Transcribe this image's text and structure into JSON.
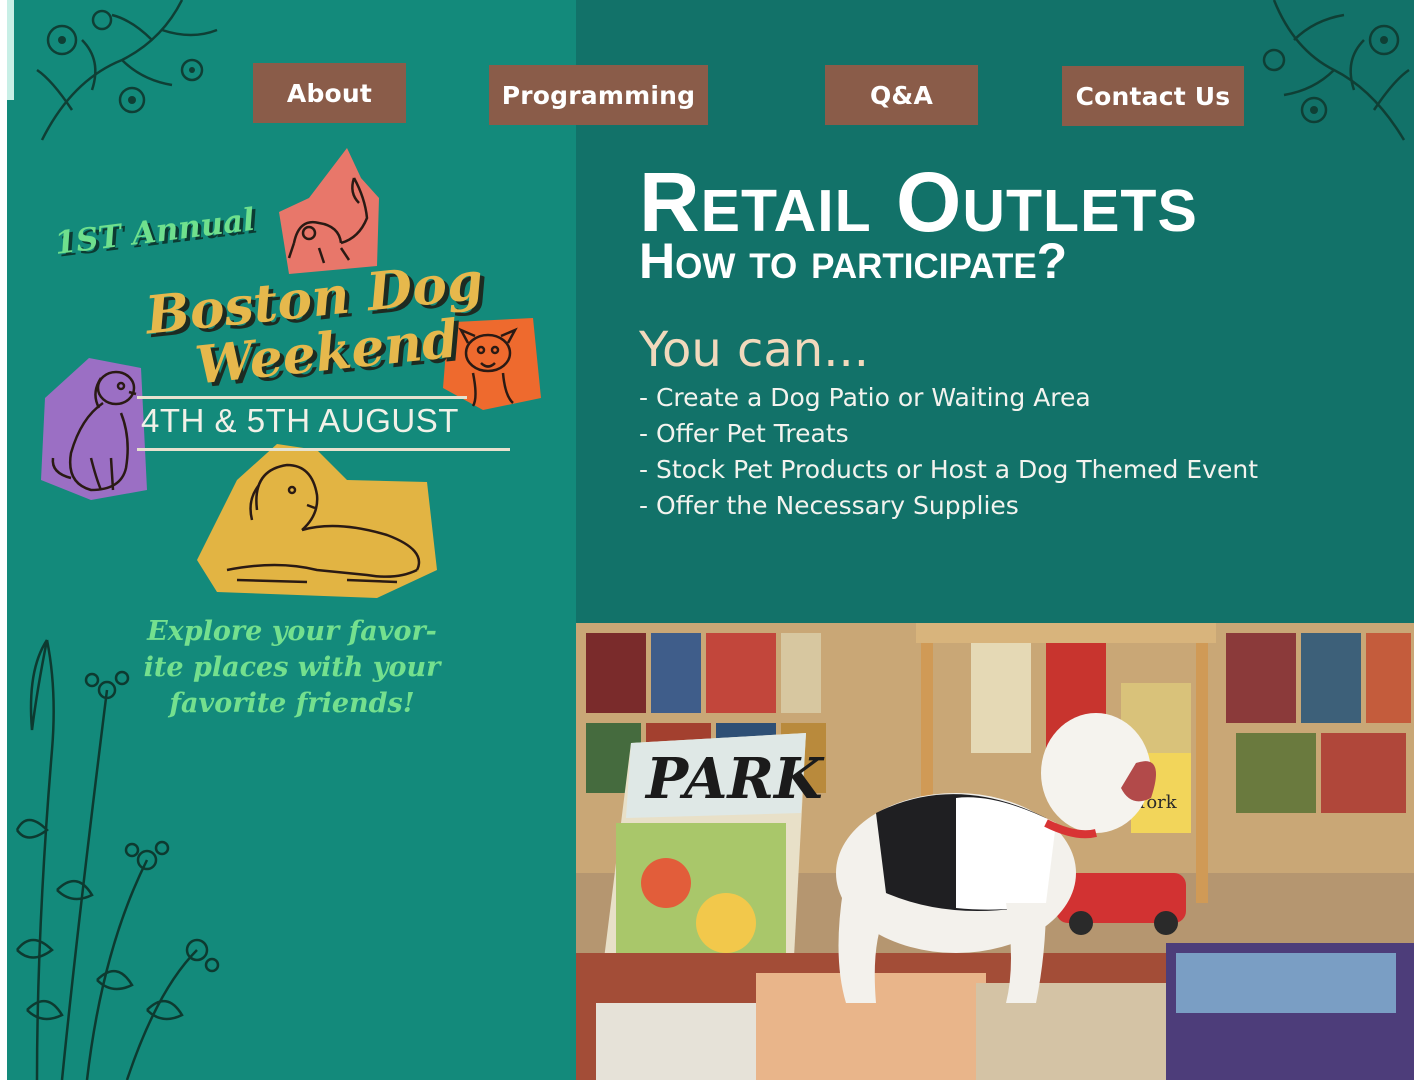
{
  "nav": {
    "about": "About",
    "programming": "Programming",
    "qa": "Q&A",
    "contact": "Contact Us"
  },
  "poster": {
    "first_annual": "1ST Annual",
    "title_line_1": "Boston Dog",
    "title_line_2": "Weekend",
    "dates": "4TH & 5TH AUGUST",
    "tagline_line_1": "Explore your favor-",
    "tagline_line_2": "ite places with your",
    "tagline_line_3": "favorite friends!"
  },
  "content": {
    "heading": "Retail Outlets",
    "subheading": "How to participate?",
    "you_can": "You can...",
    "bullets": [
      "- Create a Dog Patio or Waiting Area",
      "- Offer Pet Treats",
      "- Stock Pet Products or Host a Dog Themed Event",
      "- Offer the Necessary Supplies"
    ]
  },
  "photo": {
    "book_title": "PARK",
    "sign_text": "York"
  },
  "colors": {
    "left_panel": "#138a7b",
    "right_panel": "#127269",
    "nav_button": "#8a5c49",
    "title_gold": "#e6b84c",
    "accent_green": "#6fe08d",
    "you_can": "#f1d9bc",
    "dog_pink": "#e8776a",
    "dog_orange": "#ee6a2e",
    "dog_purple": "#9b6fc4",
    "dog_gold": "#e2b443"
  },
  "icons": [
    "floral-icon",
    "dog-stretch-icon",
    "bulldog-icon",
    "puppy-sitting-icon",
    "dog-lying-icon",
    "botanical-plant-icon"
  ]
}
